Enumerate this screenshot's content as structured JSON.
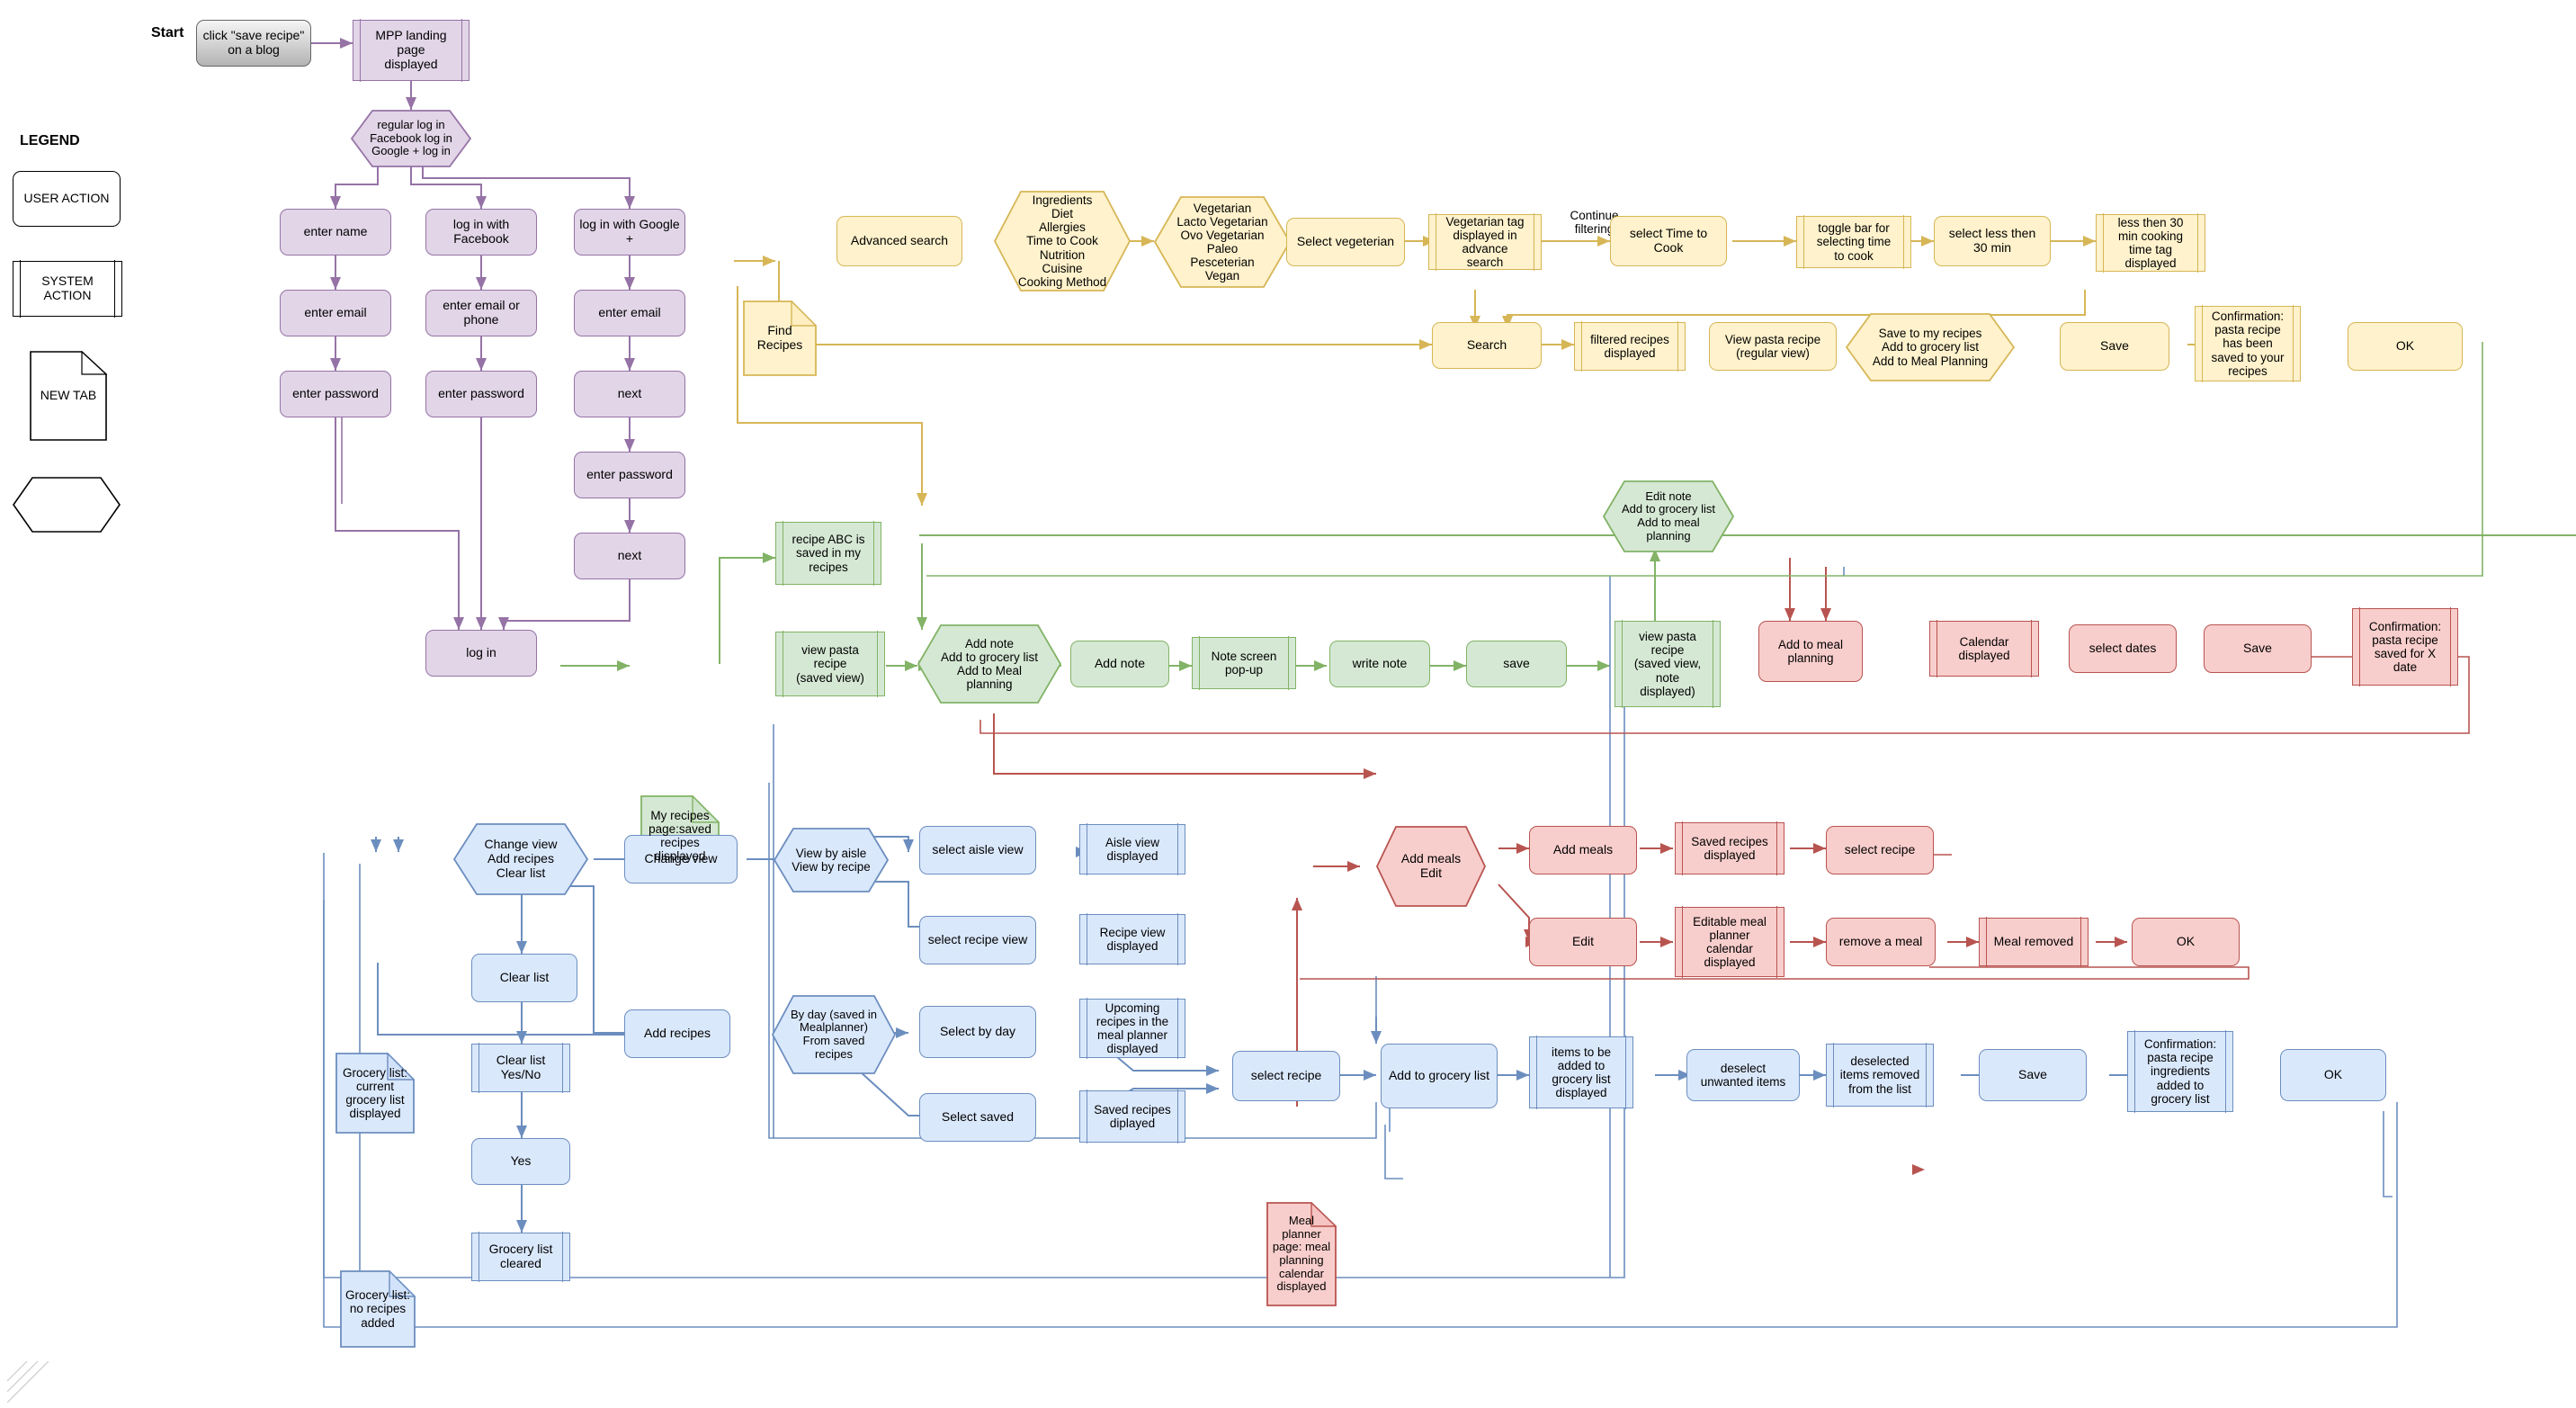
{
  "meta": {
    "start_label": "Start",
    "legend_title": "LEGEND"
  },
  "legend": {
    "items": [
      {
        "key": "user_action",
        "label": "USER ACTION",
        "shape": "rounded-rect"
      },
      {
        "key": "system_action",
        "label": "SYSTEM\nACTION",
        "shape": "bar-rect"
      },
      {
        "key": "new_tab",
        "label": "NEW TAB",
        "shape": "document"
      },
      {
        "key": "decision",
        "label": "",
        "shape": "hexagon"
      }
    ]
  },
  "colors": {
    "purple_fill": "#e1d5e7",
    "purple_stroke": "#9673a6",
    "yellow_fill": "#fff2cc",
    "yellow_stroke": "#d6b656",
    "green_fill": "#d5e8d4",
    "green_stroke": "#82b366",
    "red_fill": "#f8cecc",
    "red_stroke": "#b85450",
    "blue_fill": "#dae8fc",
    "blue_stroke": "#6c8ebf",
    "grey_stroke": "#666666"
  },
  "nodes": {
    "start_click": "click \"save recipe\"\non a blog",
    "mpp_landing": "MPP landing\npage\ndisplayed",
    "login_choice": "regular log in\nFacebook log in\nGoogle + log in",
    "enter_name": "enter name",
    "enter_email": "enter email",
    "enter_password": "enter password",
    "fb_login": "log in with\nFacebook",
    "fb_email_phone": "enter email or\nphone",
    "fb_password": "enter password",
    "google_login": "log in with Google\n+",
    "g_email": "enter email",
    "g_next1": "next",
    "g_password": "enter password",
    "g_next2": "next",
    "log_in": "log in",
    "find_recipes": "Find\nRecipes",
    "advanced_search": "Advanced search",
    "filter_options": "Ingredients\nDiet\nAllergies\nTime to Cook\nNutrition\nCuisine\nCooking Method",
    "diet_options": "Vegetarian\nLacto Vegetarian\nOvo Vegetarian\nPaleo\nPesceterian\nVegan",
    "select_vegetarian": "Select vegeterian",
    "veg_tag_displayed": "Vegetarian tag\ndisplayed in\nadvance\nsearch",
    "select_time_to_cook": "select Time to\nCook",
    "toggle_bar": "toggle bar for\nselecting time\nto cook",
    "select_less_30": "select less then\n30 min",
    "less30_tag": "less then 30\nmin cooking\ntime tag\ndisplayed",
    "search": "Search",
    "filtered_recipes": "filtered recipes\ndisplayed",
    "view_pasta_regular": "View pasta recipe\n(regular view)",
    "save_choice": "Save to my recipes\nAdd to grocery list\nAdd to Meal Planning",
    "save_btn": "Save",
    "conf_saved_recipes": "Confirmation:\npasta recipe\nhas been\nsaved to your\nrecipes",
    "ok_1": "OK",
    "recipe_abc_saved": "recipe ABC is\nsaved in my\nrecipes",
    "my_recipes_page": "My recipes\npage:saved\nrecipes\ndisplayed",
    "view_pasta_saved": "view pasta\nrecipe\n(saved view)",
    "add_note_choice": "Add note\nAdd to grocery list\nAdd to Meal\nplanning",
    "add_note": "Add note",
    "note_popup": "Note screen\npop-up",
    "write_note": "write note",
    "save_note": "save",
    "view_pasta_note": "view pasta\nrecipe\n(saved view,\nnote\ndisplayed)",
    "edit_note_choice": "Edit note\nAdd to grocery list\nAdd to meal\nplanning",
    "add_to_meal_planning": "Add to meal\nplanning",
    "calendar_displayed": "Calendar\ndisplayed",
    "select_dates": "select dates",
    "save_meal": "Save",
    "conf_saved_for_date": "Confirmation:\npasta recipe\nsaved for X\ndate",
    "grocery_current": "Grocery list:\ncurrent\ngrocery list\ndisplayed",
    "grocery_empty": "Grocery list:\nno recipes\nadded",
    "grocery_choice": "Change view\nAdd recipes\nClear list",
    "change_view": "Change view",
    "clear_list": "Clear list",
    "add_recipes": "Add recipes",
    "clear_list_yesno": "Clear list\nYes/No",
    "yes": "Yes",
    "grocery_cleared": "Grocery list\ncleared",
    "view_choice": "View by aisle\nView by recipe",
    "select_aisle_view": "select aisle view",
    "aisle_view_displayed": "Aisle view\ndisplayed",
    "select_recipe_view": "select recipe view",
    "recipe_view_displayed": "Recipe view\ndisplayed",
    "byday_choice": "By day (saved in\nMealplanner)\nFrom saved\nrecipes",
    "select_by_day": "Select by day",
    "upcoming_recipes": "Upcoming\nrecipes in the\nmeal planner\ndisplayed",
    "select_saved": "Select saved",
    "saved_recipes_diplayed": "Saved recipes\ndiplayed",
    "select_recipe_blue": "select recipe",
    "add_to_grocery_list": "Add to grocery list",
    "items_to_be_added": "items to be\nadded to\ngrocery list\ndisplayed",
    "deselect_unwanted": "deselect\nunwanted items",
    "deselected_removed": "deselected\nitems removed\nfrom the list",
    "save_grocery": "Save",
    "conf_ingredients": "Confirmation:\npasta recipe\ningredients\nadded to\ngrocery list",
    "ok_grocery": "OK",
    "meal_planner_page": "Meal\nplanner\npage: meal\nplanning\ncalendar\ndisplayed",
    "add_meals_edit": "Add meals\nEdit",
    "add_meals": "Add meals",
    "saved_recipes_displayed": "Saved recipes\ndisplayed",
    "select_recipe_red": "select recipe",
    "edit": "Edit",
    "editable_calendar": "Editable meal\nplanner\ncalendar\ndisplayed",
    "remove_a_meal": "remove a meal",
    "meal_removed": "Meal removed",
    "ok_meal": "OK"
  },
  "edge_labels": {
    "continue_filtering": "Continue\nfiltering"
  }
}
